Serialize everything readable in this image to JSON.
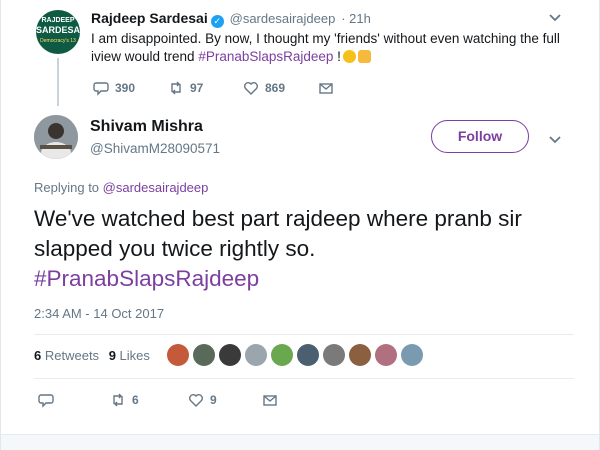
{
  "parent_tweet": {
    "avatar_line1": "RAJDEEP",
    "avatar_line2": "SARDESAI",
    "avatar_line3": "Democracy's 13",
    "name": "Rajdeep Sardesai",
    "handle": "@sardesairajdeep",
    "time": "· 21h",
    "text_before": "I am disappointed. By now, I thought my 'friends' without even watching the full iview would trend ",
    "hashtag": "#PranabSlapsRajdeep",
    "text_after": " !",
    "replies": "390",
    "retweets": "97",
    "likes": "869"
  },
  "main_tweet": {
    "name": "Shivam Mishra",
    "handle": "@ShivamM28090571",
    "follow_label": "Follow",
    "replying_prefix": "Replying to ",
    "replying_handle": "@sardesairajdeep",
    "text_line": "We've watched best part rajdeep where pranb sir slapped you twice rightly so.",
    "hashtag": "#PranabSlapsRajdeep",
    "timestamp": "2:34 AM - 14 Oct 2017",
    "retweets_count": "6",
    "retweets_label": "Retweets",
    "likes_count": "9",
    "likes_label": "Likes",
    "action_retweets": "6",
    "action_likes": "9"
  },
  "colors": {
    "accent": "#7b3fa0",
    "muted": "#657786",
    "text": "#14171a",
    "verified": "#1da1f2"
  },
  "liker_avatars": [
    "#c45a3a",
    "#5a6a5a",
    "#3a3a3a",
    "#9aa5ad",
    "#6aa84f",
    "#4a6070",
    "#7a7a7a",
    "#8a6040",
    "#b07080",
    "#7a9ab0"
  ]
}
